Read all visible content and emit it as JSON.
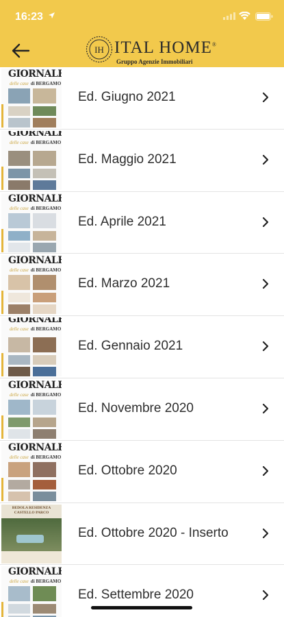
{
  "status_bar": {
    "time": "16:23"
  },
  "header": {
    "back_icon": "arrow-left-icon",
    "logo_mark": "IH",
    "logo_name": "ITAL HOME",
    "logo_tm": "®",
    "logo_subtitle": "Gruppo Agenzie Immobiliari"
  },
  "thumbnail": {
    "masthead": "GIORNALE",
    "masthead_sub_a": "delle case",
    "masthead_sub_b": "di BERGAMO",
    "insert_title": "BEDOLA RESIDENZA CASTELLO PARCO"
  },
  "editions": [
    {
      "label": "Ed.  Giugno 2021"
    },
    {
      "label": "Ed.  Maggio 2021"
    },
    {
      "label": "Ed.  Aprile 2021"
    },
    {
      "label": "Ed.  Marzo 2021"
    },
    {
      "label": "Ed. Gennaio 2021"
    },
    {
      "label": "Ed. Novembre 2020"
    },
    {
      "label": "Ed. Ottobre 2020"
    },
    {
      "label": "Ed. Ottobre 2020 - Inserto"
    },
    {
      "label": "Ed. Settembre 2020"
    }
  ],
  "colors": {
    "header_bg": "#f2c94c",
    "text": "#2e2e2e",
    "accent_gold": "#c9a33b"
  }
}
